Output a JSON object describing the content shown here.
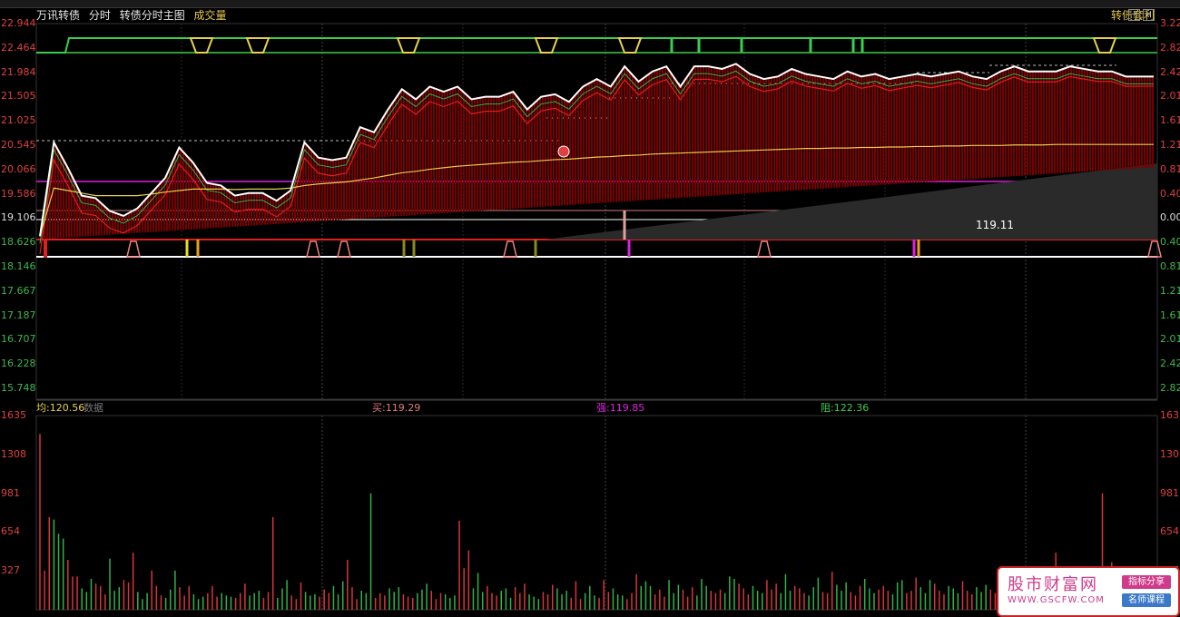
{
  "header": {
    "name": "万讯转债",
    "mode": "分时",
    "formula": "转债分时主图",
    "volume_tab": "成交量",
    "right_title": "转债套利"
  },
  "axes": {
    "left_price": [
      "22.944",
      "22.464",
      "21.984",
      "21.505",
      "21.025",
      "20.545",
      "20.066",
      "19.586",
      "19.106",
      "18.626",
      "18.146",
      "17.667",
      "17.187",
      "16.707",
      "16.228",
      "15.748"
    ],
    "right_pct": [
      "3.22",
      "2.82",
      "2.42",
      "2.01",
      "1.61",
      "1.21",
      "0.81",
      "0.40",
      "0.00",
      "0.40",
      "0.81",
      "1.21",
      "1.61",
      "2.01",
      "2.42",
      "2.82"
    ],
    "left_vol": [
      "1635",
      "1308",
      "981",
      "654",
      "327"
    ],
    "right_vol": [
      "1635",
      "1308",
      "981",
      "654",
      "327"
    ]
  },
  "price_label": "119.11",
  "subheader": {
    "avg": "均:120.56",
    "data_label": "数据",
    "buy": "买:119.29",
    "strong": "强:119.85",
    "resist": "阻:122.36"
  },
  "colors": {
    "background": "#000000",
    "up": "#d8343c",
    "down": "#2fb34a",
    "price_line": "#ffffff",
    "avg_line": "#e6d24a",
    "red_line": "#e02020",
    "band_green": "#39d04a",
    "band_yellow": "#e6d24a",
    "magenta_line": "#e020e0"
  },
  "chart_data": [
    {
      "type": "line",
      "x": [
        0,
        3,
        6,
        9,
        12,
        15,
        18,
        21,
        24,
        27,
        30,
        33,
        36,
        39,
        42,
        45,
        48,
        51,
        54,
        57,
        60,
        63,
        66,
        69,
        72,
        75,
        78,
        81,
        84,
        87,
        90,
        93,
        96,
        99,
        102,
        105,
        108,
        111,
        114,
        117,
        120,
        123,
        126,
        129,
        132,
        135,
        138,
        141,
        144,
        147,
        150,
        153,
        156,
        159,
        162,
        165,
        168,
        171,
        174,
        177,
        180,
        183,
        186,
        189,
        192,
        195,
        198,
        201,
        204,
        207,
        210,
        213,
        216,
        219,
        222,
        225,
        228,
        231,
        234,
        237,
        240
      ],
      "series": [
        {
          "values": [
            18.75,
            20.6,
            20.1,
            19.55,
            19.5,
            19.25,
            19.15,
            19.3,
            19.6,
            19.9,
            20.5,
            20.2,
            19.8,
            19.75,
            19.55,
            19.6,
            19.6,
            19.45,
            19.65,
            20.6,
            20.3,
            20.25,
            20.3,
            20.9,
            20.8,
            21.25,
            21.65,
            21.45,
            21.7,
            21.6,
            21.7,
            21.45,
            21.5,
            21.5,
            21.6,
            21.25,
            21.5,
            21.55,
            21.4,
            21.7,
            21.85,
            21.7,
            22.1,
            21.8,
            22.0,
            22.1,
            21.7,
            22.1,
            22.1,
            22.05,
            22.15,
            21.95,
            21.85,
            21.9,
            22.05,
            21.95,
            21.9,
            21.85,
            22.0,
            21.9,
            21.95,
            21.85,
            21.9,
            21.95,
            21.9,
            21.95,
            22.0,
            21.9,
            21.85,
            22.0,
            22.1,
            22.0,
            22.0,
            22.0,
            22.1,
            22.05,
            22.0,
            22.0,
            21.9,
            21.9,
            21.9
          ]
        },
        {
          "values": [
            18.75,
            19.7,
            19.65,
            19.6,
            19.55,
            19.55,
            19.55,
            19.55,
            19.58,
            19.62,
            19.65,
            19.68,
            19.68,
            19.68,
            19.67,
            19.68,
            19.68,
            19.68,
            19.7,
            19.75,
            19.78,
            19.8,
            19.82,
            19.86,
            19.9,
            19.95,
            20.0,
            20.03,
            20.07,
            20.1,
            20.13,
            20.15,
            20.17,
            20.19,
            20.21,
            20.22,
            20.24,
            20.26,
            20.27,
            20.29,
            20.31,
            20.32,
            20.34,
            20.35,
            20.37,
            20.38,
            20.39,
            20.4,
            20.41,
            20.42,
            20.43,
            20.44,
            20.45,
            20.46,
            20.47,
            20.48,
            20.48,
            20.49,
            20.49,
            20.5,
            20.5,
            20.51,
            20.51,
            20.52,
            20.52,
            20.53,
            20.53,
            20.54,
            20.54,
            20.54,
            20.55,
            20.55,
            20.55,
            20.56,
            20.56,
            20.56,
            20.56,
            20.56,
            20.56,
            20.56,
            20.56
          ]
        }
      ],
      "ylim": [
        15.748,
        22.944
      ]
    },
    {
      "type": "bar",
      "x_count": 240,
      "values": [
        1480,
        330,
        780,
        760,
        640,
        600,
        420,
        280,
        280,
        180,
        150,
        260,
        220,
        200,
        130,
        430,
        160,
        190,
        250,
        230,
        480,
        150,
        90,
        140,
        330,
        200,
        120,
        100,
        170,
        330,
        190,
        120,
        200,
        130,
        90,
        110,
        140,
        200,
        110,
        140,
        120,
        110,
        100,
        140,
        220,
        120,
        140,
        160,
        100,
        150,
        780,
        100,
        180,
        250,
        120,
        90,
        230,
        150,
        120,
        130,
        110,
        170,
        140,
        200,
        130,
        240,
        420,
        190,
        90,
        160,
        140,
        980,
        100,
        140,
        120,
        180,
        150,
        190,
        130,
        110,
        100,
        140,
        170,
        220,
        160,
        90,
        140,
        130,
        100,
        120,
        750,
        350,
        500,
        180,
        310,
        150,
        200,
        140,
        120,
        160,
        180,
        100,
        190,
        140,
        220,
        130,
        110,
        90,
        150,
        130,
        210,
        180,
        130,
        160,
        100,
        240,
        90,
        140,
        200,
        120,
        100,
        250,
        150,
        180,
        130,
        120,
        90,
        140,
        300,
        200,
        240,
        200,
        130,
        170,
        110,
        250,
        140,
        210,
        170,
        110,
        190,
        120,
        260,
        200,
        160,
        140,
        170,
        140,
        280,
        260,
        220,
        180,
        130,
        200,
        160,
        140,
        250,
        170,
        220,
        140,
        300,
        160,
        200,
        180,
        140,
        120,
        190,
        270,
        150,
        140,
        320,
        210,
        160,
        230,
        150,
        120,
        200,
        260,
        180,
        140,
        170,
        200,
        160,
        130,
        230,
        250,
        140,
        160,
        270,
        190,
        140,
        250,
        220,
        160,
        130,
        200,
        180,
        140,
        240,
        160,
        130,
        190,
        150,
        210,
        170,
        140,
        260,
        120,
        200,
        160,
        240,
        180,
        130,
        150,
        220,
        160,
        130,
        200,
        480,
        300,
        140,
        190,
        250,
        170,
        130,
        210,
        160,
        90,
        980,
        300,
        400,
        200,
        150,
        180,
        140,
        120,
        100,
        80,
        60,
        40
      ],
      "ylim": [
        0,
        1635
      ]
    }
  ]
}
